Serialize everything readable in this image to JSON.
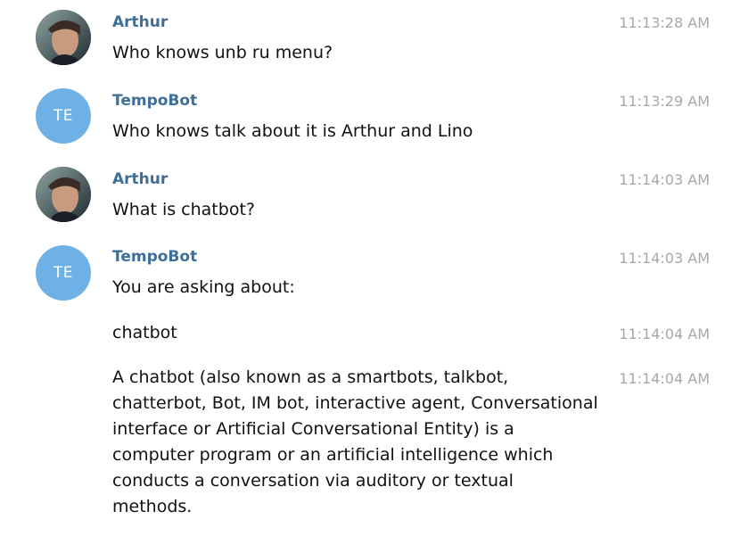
{
  "messages": [
    {
      "author": "Arthur",
      "time": "11:13:28 AM",
      "text": "Who knows unb ru menu?"
    },
    {
      "author": "TempoBot",
      "avatar_initials": "TE",
      "time": "11:13:29 AM",
      "text": "Who knows talk about it is Arthur and Lino"
    },
    {
      "author": "Arthur",
      "time": "11:14:03 AM",
      "text": "What is chatbot?"
    },
    {
      "author": "TempoBot",
      "avatar_initials": "TE",
      "time": "11:14:03 AM",
      "text": "You are asking about:"
    },
    {
      "time": "11:14:04 AM",
      "text": "chatbot"
    },
    {
      "time": "11:14:04 AM",
      "text": "A chatbot (also known as a smartbots, talkbot, chatterbot, Bot, IM bot, interactive agent, Conversational interface or Artificial Conversational Entity) is a computer program or an artificial intelligence which conducts a conversation via auditory or textual methods."
    }
  ],
  "colors": {
    "author_name": "#3e6e9b",
    "timestamp": "#a8a8a8",
    "bot_avatar_bg": "#6eb1e6",
    "message_text": "#111111"
  }
}
